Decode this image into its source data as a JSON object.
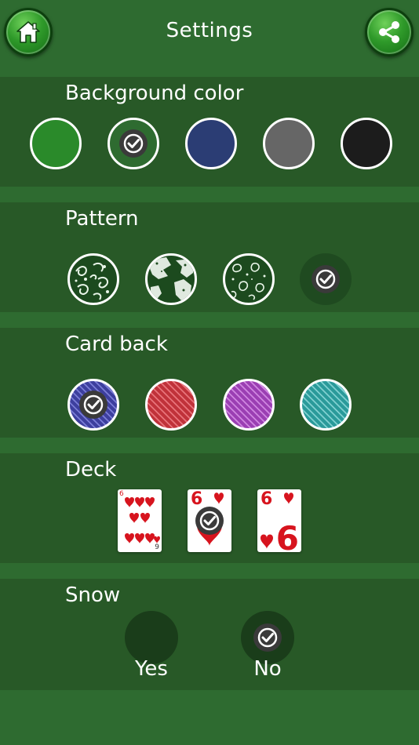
{
  "header": {
    "title": "Settings",
    "home_icon": "home-icon",
    "share_icon": "share-icon"
  },
  "background_color": {
    "label": "Background color",
    "options": [
      {
        "color": "#2a8a2a",
        "selected": false
      },
      {
        "color": "#2e6b30",
        "selected": true
      },
      {
        "color": "#2b3d74",
        "selected": false
      },
      {
        "color": "#666666",
        "selected": false
      },
      {
        "color": "#1c1c1c",
        "selected": false
      }
    ]
  },
  "pattern": {
    "label": "Pattern",
    "options": [
      {
        "name": "floral-swirl",
        "selected": false
      },
      {
        "name": "world-map",
        "selected": false
      },
      {
        "name": "paisley",
        "selected": false
      },
      {
        "name": "none",
        "selected": true
      }
    ]
  },
  "card_back": {
    "label": "Card back",
    "options": [
      {
        "color": "#3d3f9e",
        "selected": true
      },
      {
        "color": "#c0323a",
        "selected": false
      },
      {
        "color": "#9b3fb3",
        "selected": false
      },
      {
        "color": "#2a9a9a",
        "selected": false
      }
    ]
  },
  "deck": {
    "label": "Deck",
    "options": [
      {
        "style": "classic",
        "rank": "6",
        "corner_rank": "9",
        "selected": false
      },
      {
        "style": "simple",
        "rank": "6",
        "selected": true
      },
      {
        "style": "large",
        "rank": "6",
        "big_rank": "6",
        "selected": false
      }
    ]
  },
  "snow": {
    "label": "Snow",
    "yes_label": "Yes",
    "no_label": "No",
    "selected": "no"
  },
  "colors": {
    "suit_red": "#d7141e",
    "check_bg": "#3a3a3a"
  }
}
